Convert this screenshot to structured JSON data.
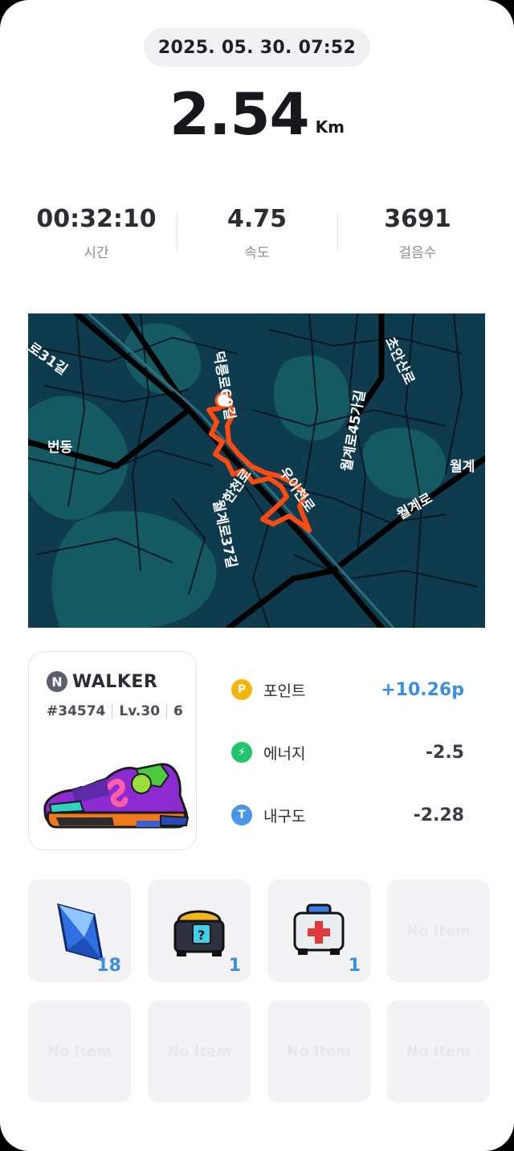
{
  "workout": {
    "datetime": "2025. 05. 30. 07:52",
    "distance": "2.54",
    "distance_unit": "Km"
  },
  "stats": [
    {
      "value": "00:32:10",
      "label": "시간"
    },
    {
      "value": "4.75",
      "label": "속도"
    },
    {
      "value": "3691",
      "label": "걸음수"
    }
  ],
  "map": {
    "labels": [
      "로31길",
      "번동",
      "덕릉로60길",
      "한천로",
      "우이천로",
      "월계로37길",
      "월계로45가길",
      "초안산로",
      "월계로",
      "월계"
    ],
    "route_color": "#ff4a10",
    "background_color": "#0f3b4f"
  },
  "shoe_card": {
    "brand": "WALKER",
    "brand_logo_letter": "N",
    "token_id": "#34574",
    "level": "Lv.30",
    "extra_icon": "6"
  },
  "rewards": [
    {
      "icon": "P",
      "label": "포인트",
      "value": "+10.26p",
      "icon_color": "#f5b40a"
    },
    {
      "icon": "⚡",
      "label": "에너지",
      "value": "-2.5",
      "icon_color": "#22c46e"
    },
    {
      "icon": "T",
      "label": "내구도",
      "value": "-2.28",
      "icon_color": "#4a94ec"
    }
  ],
  "items": [
    {
      "name": "gem",
      "count": "18"
    },
    {
      "name": "mystery-box",
      "count": "1"
    },
    {
      "name": "repair-kit",
      "count": "1"
    },
    {
      "empty_label": "No Item"
    },
    {
      "empty_label": "No Item"
    },
    {
      "empty_label": "No Item"
    },
    {
      "empty_label": "No Item"
    },
    {
      "empty_label": "No Item"
    }
  ]
}
